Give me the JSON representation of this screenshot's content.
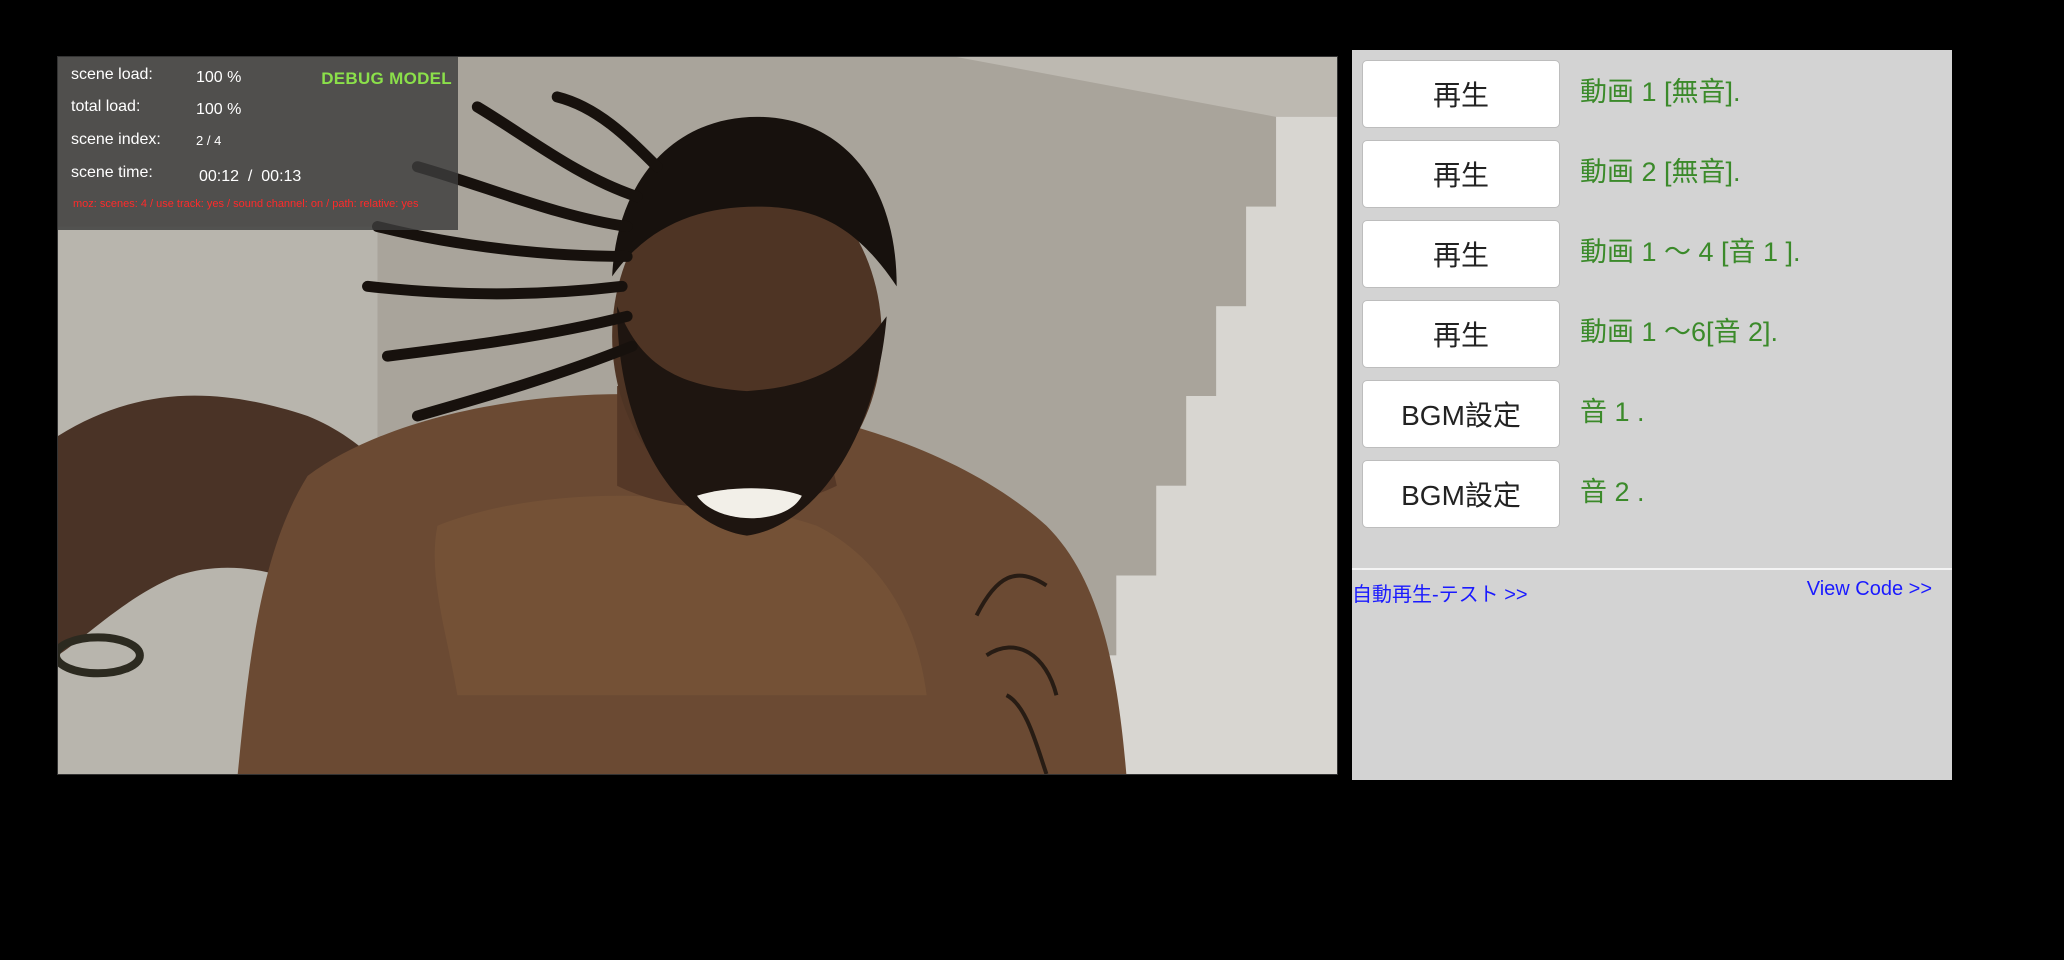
{
  "debug": {
    "title": "DEBUG MODEL",
    "scene_load_label": "scene load:",
    "scene_load_value": "100 %",
    "total_load_label": "total load:",
    "total_load_value": "100 %",
    "scene_index_label": "scene index:",
    "scene_index_value": "2 / 4",
    "scene_time_label": "scene time:",
    "scene_time_value": "00:12  /  00:13",
    "info": "moz: scenes: 4 / use track: yes / sound channel: on / path: relative: yes"
  },
  "controls": [
    {
      "button": "再生",
      "description": "動画 1 [無音]."
    },
    {
      "button": "再生",
      "description": "動画 2 [無音]."
    },
    {
      "button": "再生",
      "description": "動画 1 〜 4 [音 1 ]."
    },
    {
      "button": "再生",
      "description": "動画 1 〜6[音 2]."
    },
    {
      "button": "BGM設定",
      "description": "音 1 ."
    },
    {
      "button": "BGM設定",
      "description": "音 2 ."
    }
  ],
  "links": {
    "autoplay_test": "自動再生-テスト >>",
    "view_code": "View Code >>"
  },
  "colors": {
    "description_text": "#3b8a2a",
    "link": "#1a1aff",
    "debug_title": "#8be04a",
    "debug_info": "#ff2a2a"
  }
}
